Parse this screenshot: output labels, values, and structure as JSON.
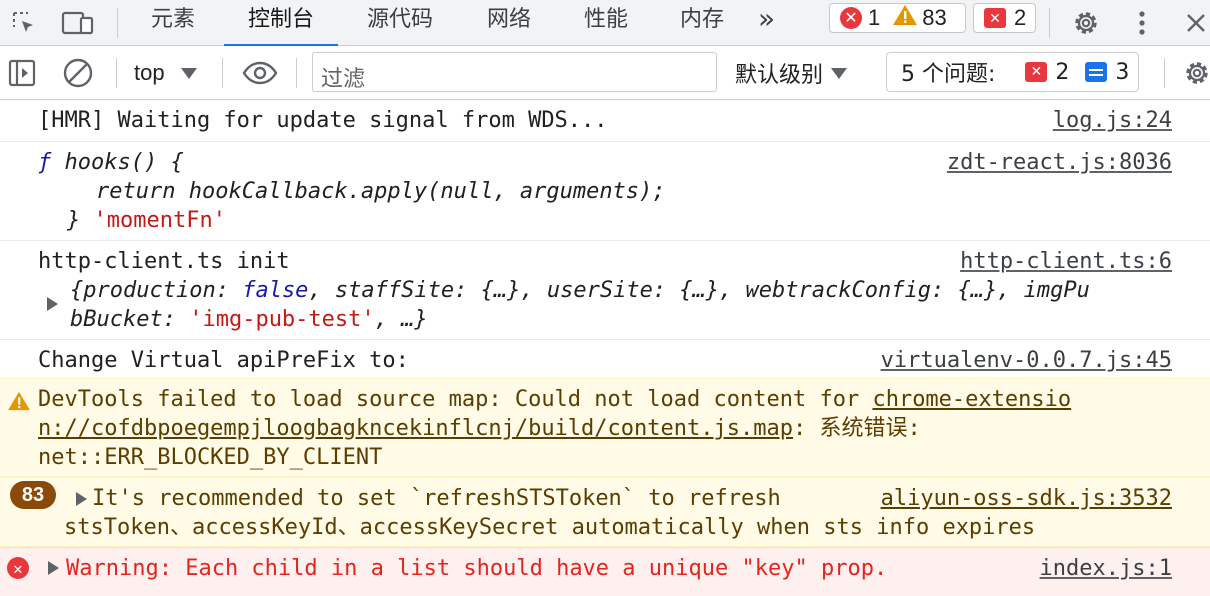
{
  "tabs": [
    {
      "label": "元素",
      "active": false
    },
    {
      "label": "控制台",
      "active": true
    },
    {
      "label": "源代码",
      "active": false
    },
    {
      "label": "网络",
      "active": false
    },
    {
      "label": "性能",
      "active": false
    },
    {
      "label": "内存",
      "active": false
    }
  ],
  "more_tabs": "»",
  "counts": {
    "errors": "1",
    "warnings": "83",
    "issues": "2"
  },
  "toolbar": {
    "context": "top",
    "filter_placeholder": "过滤",
    "level": "默认级别",
    "issues_label": "5 个问题:",
    "issues_errors": "2",
    "issues_info": "3"
  },
  "console": {
    "m1": {
      "text": "[HMR] Waiting for update signal from WDS...",
      "source": "log.js:24"
    },
    "m2": {
      "source": "zdt-react.js:8036",
      "line1_f": "ƒ",
      "line1_rest": "hooks() {",
      "line2": "return hookCallback.apply(null, arguments);",
      "line3_close": "}",
      "line3_str": "'momentFn'"
    },
    "m3": {
      "text": "http-client.ts init",
      "source": "http-client.ts:6",
      "obj_a": "{production",
      "obj_b": ": ",
      "obj_false": "false",
      "obj_c": ", staffSite: {…}, userSite: {…}, webtrackConfig: {…}, imgPu",
      "obj_d": "bBucket: ",
      "obj_str": "'img-pub-test'",
      "obj_e": ", …}"
    },
    "m4": {
      "text": "Change Virtual apiPreFix to:",
      "source": "virtualenv-0.0.7.js:45"
    },
    "m5": {
      "text1": "DevTools failed to load source map: Could not load content for ",
      "link1": "chrome-extensio",
      "link2": "n://cofdbpoegempjloogbagkncekinflcnj/build/content.js.map",
      "text2": ": 系统错误:",
      "text3": "net::ERR_BLOCKED_BY_CLIENT"
    },
    "m6": {
      "count": "83",
      "text1": "It's recommended to set `refreshSTSToken` to refresh",
      "source": "aliyun-oss-sdk.js:3532",
      "text2": "stsToken、accessKeyId、accessKeySecret automatically when sts info expires"
    },
    "m7": {
      "text": "Warning: Each child in a list should have a unique \"key\" prop.",
      "source": "index.js:1"
    }
  }
}
